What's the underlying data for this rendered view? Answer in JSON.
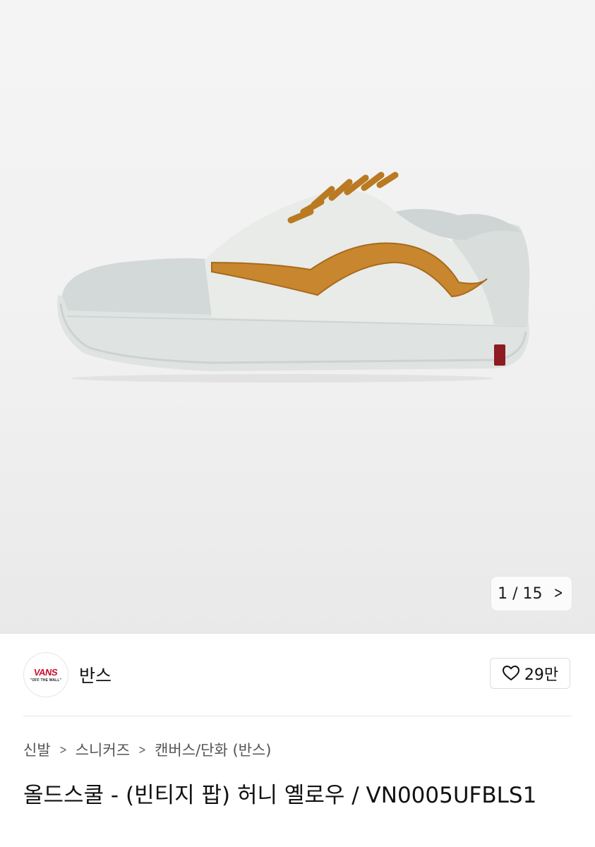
{
  "gallery": {
    "current": 1,
    "total": 15,
    "counter_text": "1 / 15",
    "next_icon": "chevron-right-icon",
    "image_alt": "Vans Old Skool Vintage Pop Honey Yellow sneaker"
  },
  "brand": {
    "logo_text": "VANS",
    "logo_tagline": "\"OFF THE WALL\"",
    "name": "반스",
    "logo_color": "#c8102e"
  },
  "like": {
    "icon": "heart-outline-icon",
    "count": "29만"
  },
  "breadcrumb": {
    "items": [
      "신발",
      "스니커즈",
      "캔버스/단화 (반스)"
    ]
  },
  "product": {
    "title": "올드스쿨 - (빈티지 팝) 허니 옐로우 / VN0005UFBLS1"
  }
}
